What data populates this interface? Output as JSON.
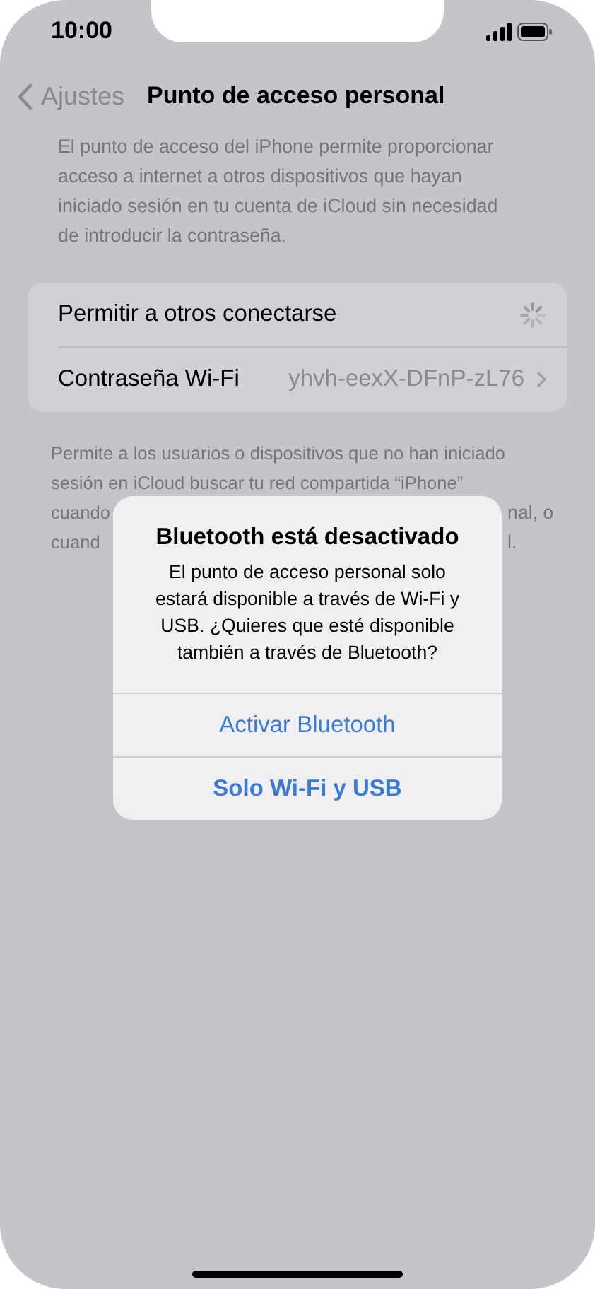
{
  "status_bar": {
    "time": "10:00"
  },
  "nav": {
    "back": "Ajustes",
    "title": "Punto de acceso personal"
  },
  "description": "El punto de acceso del iPhone permite proporcionar acceso a internet a otros dispositivos que hayan iniciado sesión en tu cuenta de iCloud sin necesidad de introducir la contraseña.",
  "settings": [
    {
      "kind": "loading",
      "label": "Permitir a otros conectarse"
    },
    {
      "kind": "detail",
      "label": "Contraseña Wi-Fi",
      "value": "yhvh-eexX-DFnP-zL76"
    }
  ],
  "footer_lines": [
    {
      "left": "Permite a los usuarios o dispositivos que no han iniciado"
    },
    {
      "left": "sesión en iCloud buscar tu red compartida “iPhone”"
    },
    {
      "left": "cuando",
      "right": "nal, o"
    },
    {
      "left": "cuand",
      "right": "l."
    }
  ],
  "alert": {
    "title": "Bluetooth está desactivado",
    "message": "El punto de acceso personal solo estará disponible a través de Wi-Fi y USB. ¿Quieres que esté disponible también a través de Bluetooth?",
    "buttons": [
      {
        "label": "Activar Bluetooth",
        "bold": false
      },
      {
        "label": "Solo Wi-Fi y USB",
        "bold": true
      }
    ]
  }
}
